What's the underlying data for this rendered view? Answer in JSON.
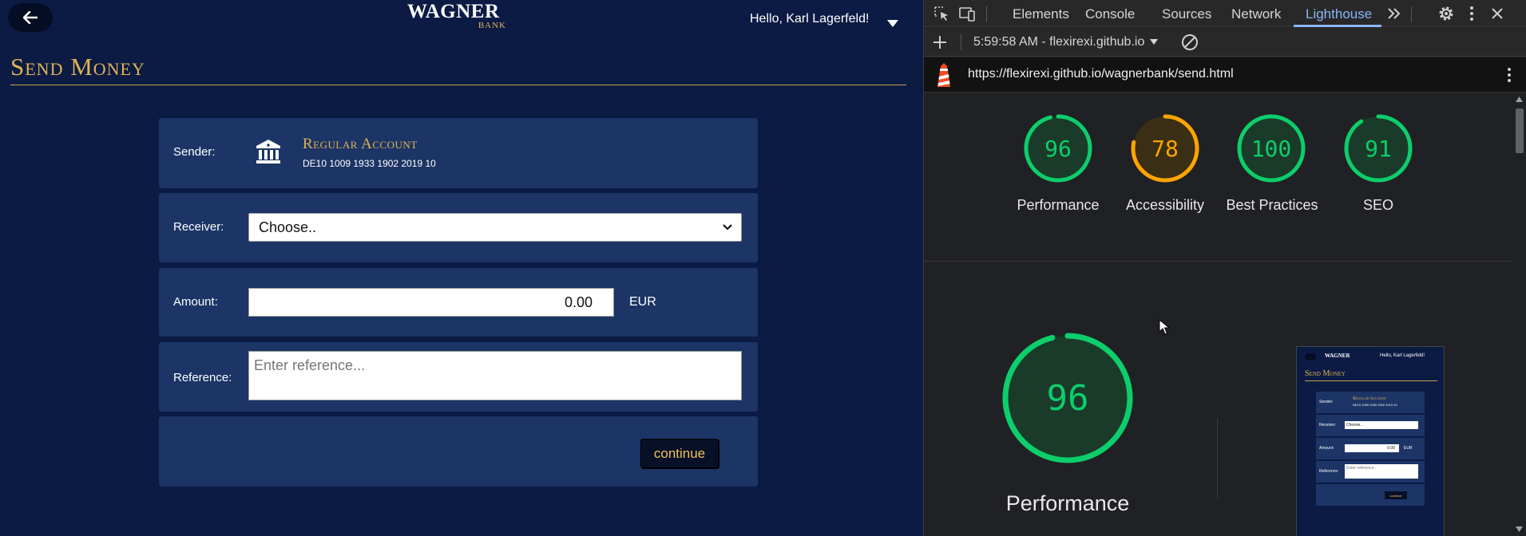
{
  "bank": {
    "logo": {
      "main": "WAGNER",
      "sub": "BANK"
    },
    "greeting": "Hello, Karl Lagerfeld!",
    "page_title": "Send Money",
    "sender": {
      "label": "Sender:",
      "account_name": "Regular Account",
      "iban": "DE10 1009 1933 1902 2019 10"
    },
    "receiver": {
      "label": "Receiver:",
      "selected": "Choose.."
    },
    "amount": {
      "label": "Amount:",
      "value": "0.00",
      "currency": "EUR"
    },
    "reference": {
      "label": "Reference:",
      "placeholder": "Enter reference..."
    },
    "continue_label": "continue",
    "colors": {
      "background": "#0c1b44",
      "card": "#1c3566",
      "gold": "#e0b354"
    }
  },
  "devtools": {
    "tabs": [
      "Elements",
      "Console",
      "Sources",
      "Network",
      "Lighthouse"
    ],
    "active_tab": "Lighthouse",
    "run_label": "5:59:58 AM - flexirexi.github.io",
    "url": "https://flexirexi.github.io/wagnerbank/send.html",
    "scores": [
      {
        "name": "Performance",
        "value": 96,
        "color": "#0cce6b"
      },
      {
        "name": "Accessibility",
        "value": 78,
        "color": "#ffa400"
      },
      {
        "name": "Best Practices",
        "value": 100,
        "color": "#0cce6b"
      },
      {
        "name": "SEO",
        "value": 91,
        "color": "#0cce6b"
      }
    ],
    "main_score": {
      "name": "Performance",
      "value": 96
    },
    "thumbnail": {
      "greeting": "Hello, Karl Lagerfeld!",
      "title": "Send Money",
      "account_name": "Regular Account",
      "iban": "DE10 1009 1933 1902 2019 10",
      "receiver": "Choose..",
      "amount": "0.00",
      "currency": "EUR",
      "reference": "Enter reference...",
      "continue": "continue",
      "labels": [
        "Sender:",
        "Receiver:",
        "Amount:",
        "Reference:"
      ]
    }
  }
}
